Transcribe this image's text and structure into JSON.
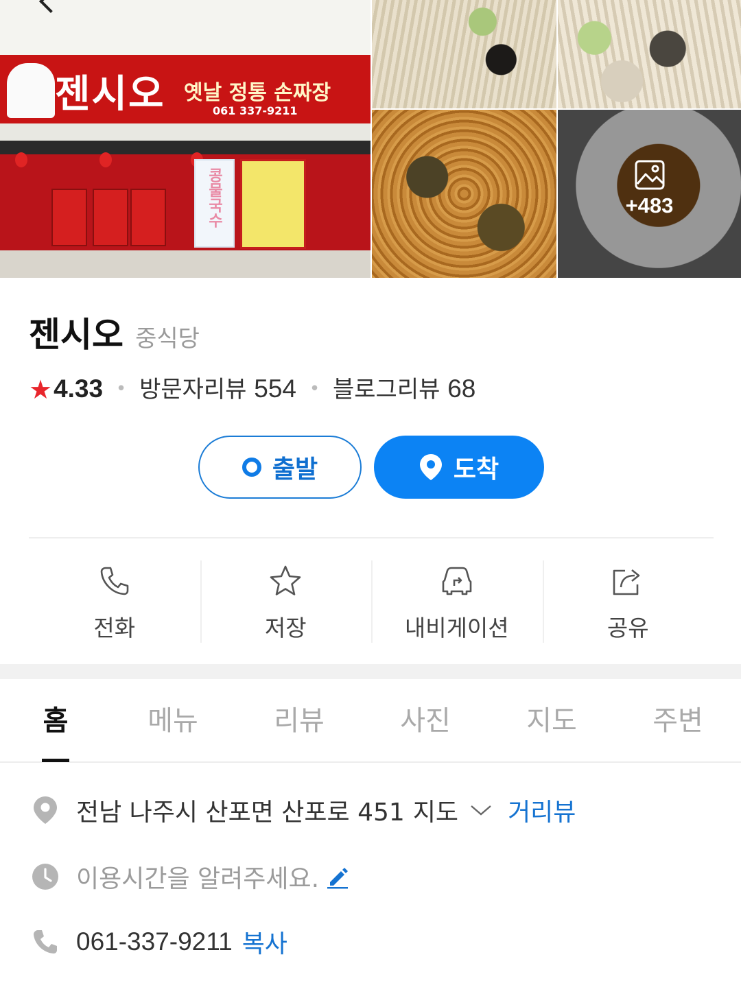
{
  "gallery": {
    "storefront_sign": "젠시오",
    "storefront_sub": "옛날 정통 손짜장",
    "storefront_phone": "061 337-9211",
    "banner_text": "콩물국수",
    "more_count": "+483"
  },
  "place": {
    "name": "젠시오",
    "category": "중식당"
  },
  "rating": {
    "score": "4.33",
    "visitor_reviews_label": "방문자리뷰",
    "visitor_reviews_count": "554",
    "blog_reviews_label": "블로그리뷰",
    "blog_reviews_count": "68"
  },
  "route": {
    "start_label": "출발",
    "arrive_label": "도착"
  },
  "actions": [
    {
      "label": "전화",
      "icon": "phone-icon"
    },
    {
      "label": "저장",
      "icon": "star-outline-icon"
    },
    {
      "label": "내비게이션",
      "icon": "car-navigation-icon"
    },
    {
      "label": "공유",
      "icon": "share-icon"
    }
  ],
  "tabs": [
    "홈",
    "메뉴",
    "리뷰",
    "사진",
    "지도",
    "주변"
  ],
  "active_tab": "홈",
  "info": {
    "address": "전남 나주시 산포면 산포로 451",
    "map_label": "지도",
    "street_view_label": "거리뷰",
    "hours_prompt": "이용시간을 알려주세요.",
    "phone": "061-337-9211",
    "copy_label": "복사"
  },
  "colors": {
    "accent_blue": "#0c83f4",
    "link_blue": "#1573d1",
    "star_red": "#e8262c"
  }
}
